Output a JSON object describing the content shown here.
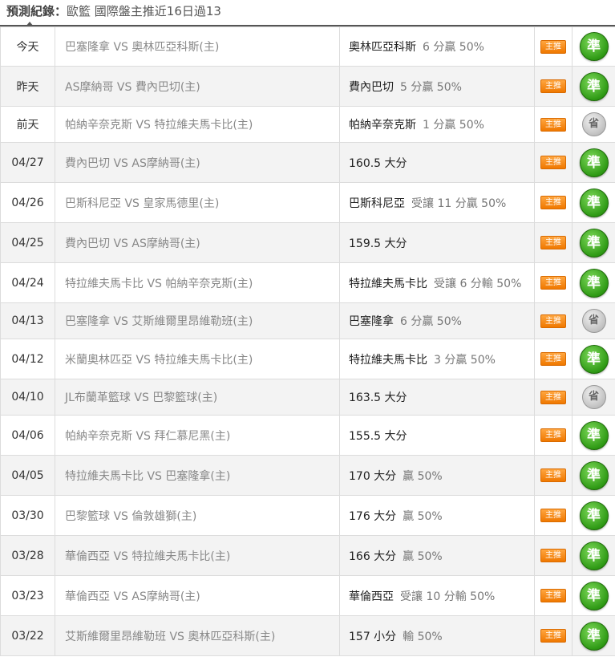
{
  "header": {
    "title": "預測紀錄",
    "separator": "：",
    "subtitle": "歐籃 國際盤主推近16日過13"
  },
  "badge_label": "主推",
  "records": [
    {
      "date": "今天",
      "match": "巴塞隆拿 VS 奧林匹亞科斯(主)",
      "pick_team": "奧林匹亞科斯",
      "pick_detail": "6 分贏 50%",
      "result": "準",
      "result_type": "win"
    },
    {
      "date": "昨天",
      "match": "AS摩納哥 VS 費內巴切(主)",
      "pick_team": "費內巴切",
      "pick_detail": "5 分贏 50%",
      "result": "準",
      "result_type": "win"
    },
    {
      "date": "前天",
      "match": "帕納辛奈克斯 VS 特拉維夫馬卡比(主)",
      "pick_team": "帕納辛奈克斯",
      "pick_detail": "1 分贏 50%",
      "result": "省",
      "result_type": "push"
    },
    {
      "date": "04/27",
      "match": "費內巴切 VS AS摩納哥(主)",
      "pick_team": "160.5 大分",
      "pick_detail": "",
      "result": "準",
      "result_type": "win"
    },
    {
      "date": "04/26",
      "match": "巴斯科尼亞 VS 皇家馬德里(主)",
      "pick_team": "巴斯科尼亞",
      "pick_detail": "受讓 11 分贏 50%",
      "result": "準",
      "result_type": "win"
    },
    {
      "date": "04/25",
      "match": "費內巴切 VS AS摩納哥(主)",
      "pick_team": "159.5 大分",
      "pick_detail": "",
      "result": "準",
      "result_type": "win"
    },
    {
      "date": "04/24",
      "match": "特拉維夫馬卡比 VS 帕納辛奈克斯(主)",
      "pick_team": "特拉維夫馬卡比",
      "pick_detail": "受讓 6 分輸 50%",
      "result": "準",
      "result_type": "win"
    },
    {
      "date": "04/13",
      "match": "巴塞隆拿 VS 艾斯維爾里昂維勒班(主)",
      "pick_team": "巴塞隆拿",
      "pick_detail": "6 分贏 50%",
      "result": "省",
      "result_type": "push"
    },
    {
      "date": "04/12",
      "match": "米蘭奧林匹亞 VS 特拉維夫馬卡比(主)",
      "pick_team": "特拉維夫馬卡比",
      "pick_detail": "3 分贏 50%",
      "result": "準",
      "result_type": "win"
    },
    {
      "date": "04/10",
      "match": "JL布蘭革籃球 VS 巴黎籃球(主)",
      "pick_team": "163.5 大分",
      "pick_detail": "",
      "result": "省",
      "result_type": "push"
    },
    {
      "date": "04/06",
      "match": "帕納辛奈克斯 VS 拜仁慕尼黑(主)",
      "pick_team": "155.5 大分",
      "pick_detail": "",
      "result": "準",
      "result_type": "win"
    },
    {
      "date": "04/05",
      "match": "特拉維夫馬卡比 VS 巴塞隆拿(主)",
      "pick_team": "170 大分",
      "pick_detail": "贏 50%",
      "result": "準",
      "result_type": "win"
    },
    {
      "date": "03/30",
      "match": "巴黎籃球 VS 倫敦雄獅(主)",
      "pick_team": "176 大分",
      "pick_detail": "贏 50%",
      "result": "準",
      "result_type": "win"
    },
    {
      "date": "03/28",
      "match": "華倫西亞 VS 特拉維夫馬卡比(主)",
      "pick_team": "166 大分",
      "pick_detail": "贏 50%",
      "result": "準",
      "result_type": "win"
    },
    {
      "date": "03/23",
      "match": "華倫西亞 VS AS摩納哥(主)",
      "pick_team": "華倫西亞",
      "pick_detail": "受讓 10 分輸 50%",
      "result": "準",
      "result_type": "win"
    },
    {
      "date": "03/22",
      "match": "艾斯維爾里昂維勒班 VS 奧林匹亞科斯(主)",
      "pick_team": "157 小分",
      "pick_detail": "輸 50%",
      "result": "準",
      "result_type": "win"
    }
  ]
}
